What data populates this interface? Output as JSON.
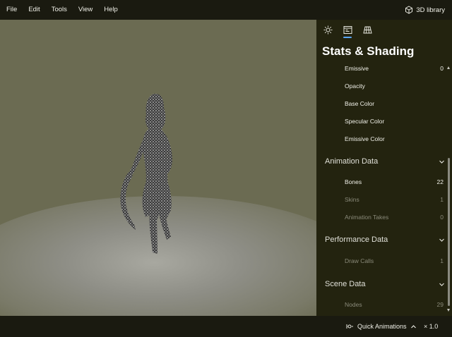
{
  "menu": {
    "items": [
      "File",
      "Edit",
      "Tools",
      "View",
      "Help"
    ]
  },
  "library": {
    "label": "3D library",
    "icon": "cube-icon"
  },
  "panel": {
    "tabs": [
      {
        "icon": "sun-icon",
        "active": false
      },
      {
        "icon": "stats-icon",
        "active": true
      },
      {
        "icon": "grid-icon",
        "active": false
      }
    ],
    "title": "Stats & Shading",
    "rows_top": [
      {
        "label": "Emissive",
        "value": "0"
      },
      {
        "label": "Opacity",
        "value": ""
      },
      {
        "label": "Base Color",
        "value": ""
      },
      {
        "label": "Specular Color",
        "value": ""
      },
      {
        "label": "Emissive Color",
        "value": ""
      }
    ],
    "animation": {
      "title": "Animation Data",
      "rows": [
        {
          "label": "Bones",
          "value": "22"
        },
        {
          "label": "Skins",
          "value": "1"
        },
        {
          "label": "Animation Takes",
          "value": "0"
        }
      ]
    },
    "performance": {
      "title": "Performance Data",
      "rows": [
        {
          "label": "Draw Calls",
          "value": "1"
        }
      ]
    },
    "scene": {
      "title": "Scene Data",
      "rows": [
        {
          "label": "Nodes",
          "value": "29"
        }
      ]
    }
  },
  "status": {
    "quick_animations": "Quick Animations",
    "speed": "× 1.0"
  },
  "colors": {
    "accent": "#58a6ff",
    "panel_bg": "#23230f",
    "viewport_bg": "#6b6b52"
  }
}
